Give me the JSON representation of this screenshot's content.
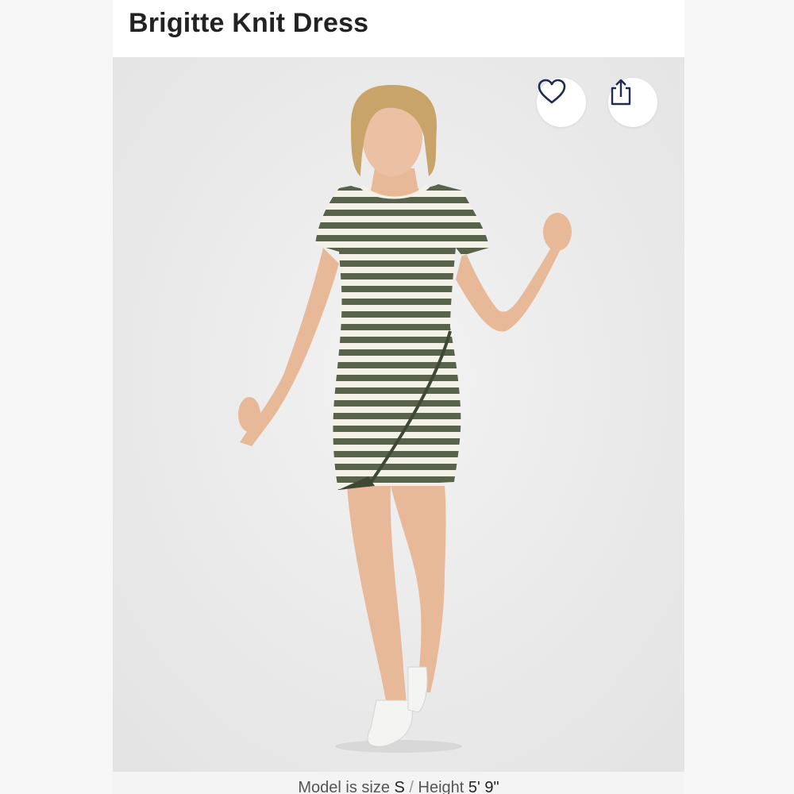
{
  "product": {
    "title": "Brigitte Knit Dress"
  },
  "actions": {
    "favorite_icon": "heart-icon",
    "share_icon": "share-icon"
  },
  "model_info": {
    "size_label": "Model is size",
    "size_value": "S",
    "separator": "/",
    "height_label": "Height",
    "height_value": "5' 9\""
  },
  "colors": {
    "stripe_dark": "#59624a",
    "stripe_light": "#f3f1e6",
    "title_text": "#222222"
  }
}
